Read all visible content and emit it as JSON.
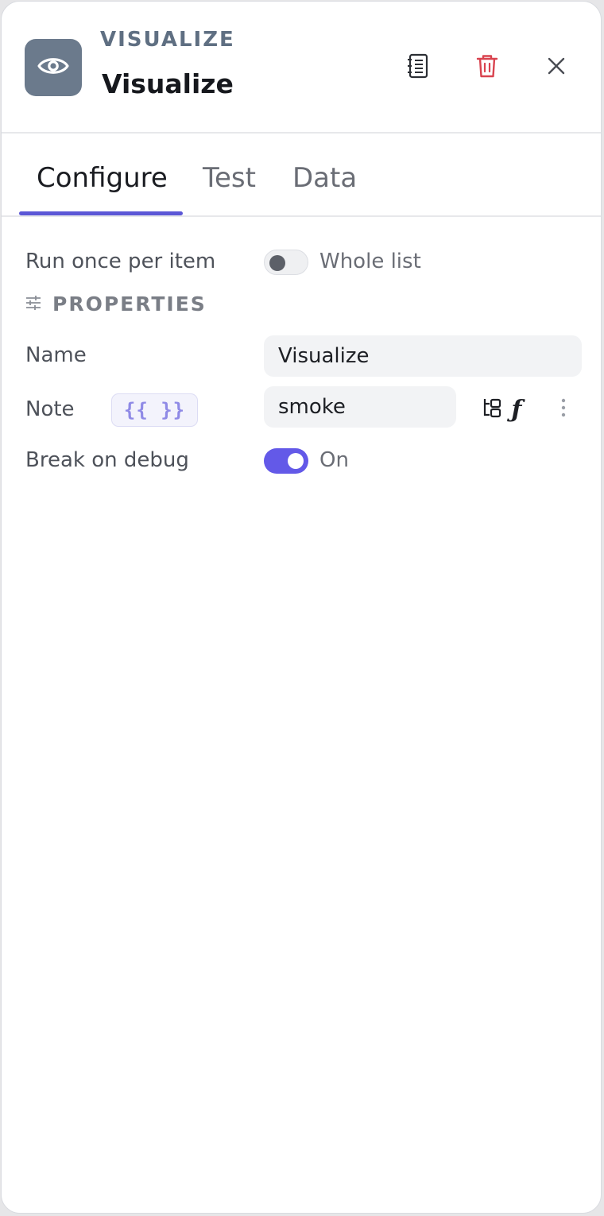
{
  "header": {
    "node_type": "VISUALIZE",
    "node_title": "Visualize",
    "icon": "eye-icon",
    "icon_bg": "#6b7a8c",
    "actions": {
      "docs_icon": "notebook-icon",
      "delete_icon": "trash-icon",
      "close_icon": "close-icon"
    }
  },
  "tabs": [
    {
      "label": "Configure",
      "active": true
    },
    {
      "label": "Test",
      "active": false
    },
    {
      "label": "Data",
      "active": false
    }
  ],
  "form": {
    "run_once": {
      "label": "Run once per item",
      "toggle_state": "off",
      "toggle_label": "Whole list"
    },
    "properties": {
      "title": "PROPERTIES",
      "icon": "sliders-icon"
    },
    "name": {
      "label": "Name",
      "value": "Visualize"
    },
    "note": {
      "label": "Note",
      "expression_badge": "{{ }}",
      "value": "smoke",
      "actions": [
        "data-tree-icon",
        "function-icon",
        "more-vertical-icon"
      ],
      "fx_glyph": "ƒ"
    },
    "break_on_debug": {
      "label": "Break on debug",
      "toggle_state": "on",
      "toggle_label": "On"
    }
  },
  "colors": {
    "accent": "#6359e8",
    "tab_underline": "#5b57d6",
    "delete": "#d9434f"
  }
}
